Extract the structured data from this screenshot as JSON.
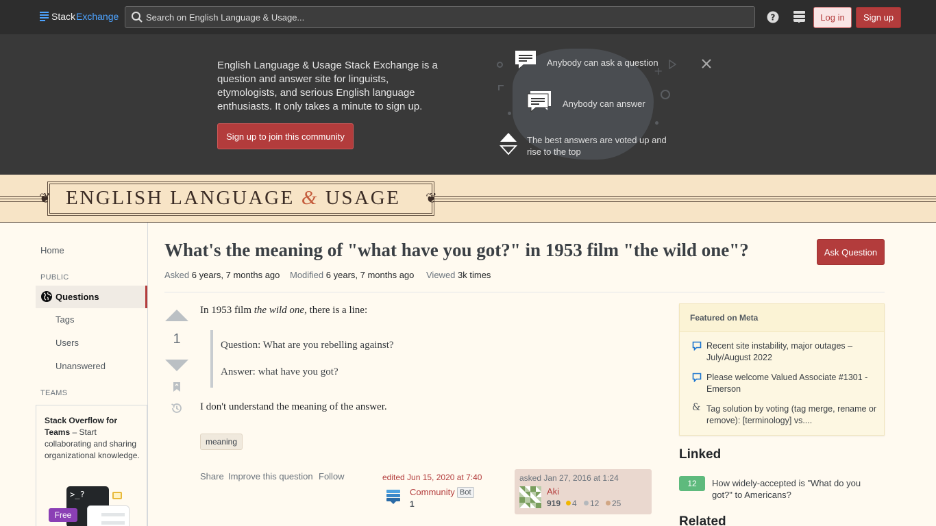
{
  "topbar": {
    "logo_stack": "Stack",
    "logo_exchange": "Exchange",
    "search_placeholder": "Search on English Language & Usage...",
    "login_label": "Log in",
    "signup_label": "Sign up"
  },
  "banner": {
    "description": "English Language & Usage Stack Exchange is a question and answer site for linguists, etymologists, and serious English language enthusiasts. It only takes a minute to sign up.",
    "cta_label": "Sign up to join this community",
    "features": [
      "Anybody can ask a question",
      "Anybody can answer",
      "The best answers are voted up and rise to the top"
    ]
  },
  "site": {
    "title_part1": "ENGLISH LANGUAGE",
    "title_amp": "&",
    "title_part2": "USAGE"
  },
  "leftnav": {
    "home": "Home",
    "public_heading": "PUBLIC",
    "questions": "Questions",
    "tags": "Tags",
    "users": "Users",
    "unanswered": "Unanswered",
    "teams_heading": "TEAMS",
    "teams_title": "Stack Overflow for Teams",
    "teams_dash": " – ",
    "teams_body": "Start collaborating and sharing organizational knowledge.",
    "teams_free": "Free",
    "teams_terminal": ">_?"
  },
  "question": {
    "title": "What's the meaning of \"what have you got?\" in 1953 film \"the wild one\"?",
    "ask_button": "Ask Question",
    "asked_label": "Asked",
    "asked_value": "6 years, 7 months ago",
    "modified_label": "Modified",
    "modified_value": "6 years, 7 months ago",
    "viewed_label": "Viewed",
    "viewed_value": "3k times",
    "vote_count": "1",
    "body_p1_a": "In 1953 film ",
    "body_p1_em": "the wild one",
    "body_p1_b": ", there is a line:",
    "quote_line1": "Question: What are you rebelling against?",
    "quote_line2": "Answer: what have you got?",
    "body_p2": "I don't understand the meaning of the answer.",
    "tags": [
      "meaning"
    ],
    "actions": [
      "Share",
      "Improve this question",
      "Follow"
    ],
    "edited": "edited Jun 15, 2020 at 7:40",
    "editor_name": "Community",
    "editor_badge": "Bot",
    "editor_rep": "1",
    "asked_card": "asked Jan 27, 2016 at 1:24",
    "owner_name": "Aki",
    "owner_rep": "919",
    "owner_gold": "4",
    "owner_silver": "12",
    "owner_bronze": "25"
  },
  "sidebar": {
    "featured_heading": "Featured on Meta",
    "featured_items": [
      "Recent site instability, major outages – July/August 2022",
      "Please welcome Valued Associate #1301 - Emerson",
      "Tag solution by voting (tag merge, rename or remove): [terminology] vs...."
    ],
    "linked_heading": "Linked",
    "linked_items": [
      {
        "score": "12",
        "title": "How widely-accepted is \"What do you got?\" to Americans?"
      }
    ],
    "related_heading": "Related"
  },
  "colors": {
    "brand_red": "#b33c3c",
    "topbar_bg": "#2d2d2d",
    "banner_bg": "#393939",
    "site_header_bg": "#f7e4c6",
    "page_bg": "#fffaf0",
    "accepted_green": "#5eba7d"
  }
}
